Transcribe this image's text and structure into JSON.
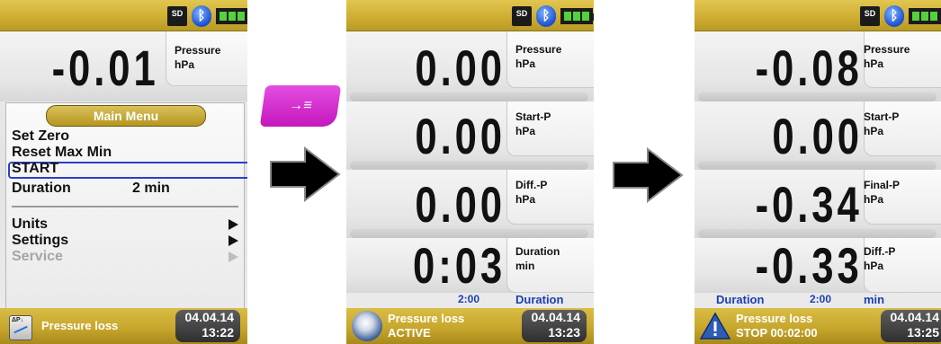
{
  "screen1": {
    "reading": {
      "value": "-0.01",
      "label": "Pressure",
      "unit": "hPa"
    },
    "menu": {
      "title": "Main Menu",
      "items": [
        {
          "label": "Set Zero"
        },
        {
          "label": "Reset Max Min"
        },
        {
          "label": "START"
        },
        {
          "label": "Duration",
          "value": "2 min"
        },
        {
          "label": "Units"
        },
        {
          "label": "Settings"
        },
        {
          "label": "Service"
        }
      ]
    },
    "footer": {
      "title": "Pressure loss",
      "date": "04.04.14",
      "time": "13:22"
    }
  },
  "key": {
    "label": "→≡"
  },
  "screen2": {
    "readings": [
      {
        "value": "0.00",
        "label": "Pressure",
        "unit": "hPa"
      },
      {
        "value": "0.00",
        "label": "Start-P",
        "unit": "hPa"
      },
      {
        "value": "0.00",
        "label": "Diff.-P",
        "unit": "hPa"
      },
      {
        "value": "0:03",
        "label": "Duration",
        "unit": "min"
      }
    ],
    "duration_row": {
      "value": "2:00",
      "label": "Duration"
    },
    "footer": {
      "title": "Pressure loss",
      "status": "ACTIVE",
      "date": "04.04.14",
      "time": "13:23"
    }
  },
  "screen3": {
    "readings": [
      {
        "value": "-0.08",
        "label": "Pressure",
        "unit": "hPa"
      },
      {
        "value": "0.00",
        "label": "Start-P",
        "unit": "hPa"
      },
      {
        "value": "-0.34",
        "label": "Final-P",
        "unit": "hPa"
      },
      {
        "value": "-0.33",
        "label": "Diff.-P",
        "unit": "hPa"
      }
    ],
    "duration_row": {
      "label": "Duration",
      "value": "2:00",
      "unit": "min"
    },
    "footer": {
      "title": "Pressure loss",
      "status": "STOP 00:02:00",
      "date": "04.04.14",
      "time": "13:25"
    }
  },
  "status_icons": {
    "sd": "SD",
    "bluetooth": "bluetooth-icon",
    "battery": "battery-icon"
  },
  "colors": {
    "accent_gold": "#cfae32",
    "highlight_blue": "#1c3fb5",
    "key_magenta": "#d81ad0"
  }
}
